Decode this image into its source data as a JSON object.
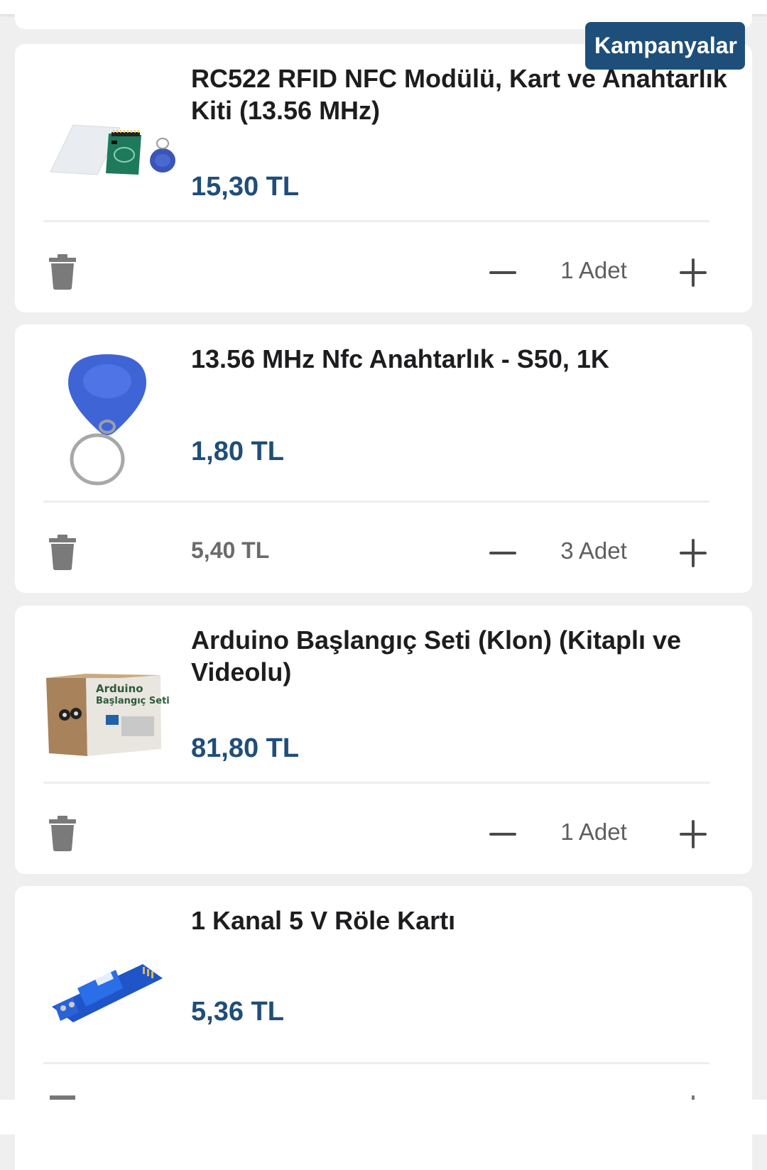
{
  "banner": {
    "label": "Kampanyalar"
  },
  "cart_items": [
    {
      "title": "RC522 RFID NFC Modülü, Kart ve Anahtarlık Kiti (13.56 MHz)",
      "price": "15,30 TL",
      "subtotal": "",
      "quantity": "1  Adet",
      "image": "rfid-kit-image"
    },
    {
      "title": "13.56 MHz Nfc Anahtarlık - S50, 1K",
      "price": "1,80 TL",
      "subtotal": "5,40 TL",
      "quantity": "3  Adet",
      "image": "nfc-keychain-image"
    },
    {
      "title": "Arduino Başlangıç Seti (Klon) (Kitaplı ve Videolu)",
      "price": "81,80 TL",
      "subtotal": "",
      "quantity": "1  Adet",
      "image": "arduino-kit-box-image",
      "box_text_1": "Arduino",
      "box_text_2": "Başlangıç Seti"
    },
    {
      "title": "1 Kanal 5 V Röle Kartı",
      "price": "5,36 TL",
      "subtotal": "",
      "quantity": "",
      "image": "relay-board-image"
    }
  ],
  "icons": {
    "delete": "trash-icon",
    "decrease": "minus-icon",
    "increase": "plus-icon"
  },
  "colors": {
    "price": "#1f4e79",
    "banner_bg": "#1e4f7a",
    "page_bg": "#efefef",
    "card_bg": "#ffffff"
  }
}
